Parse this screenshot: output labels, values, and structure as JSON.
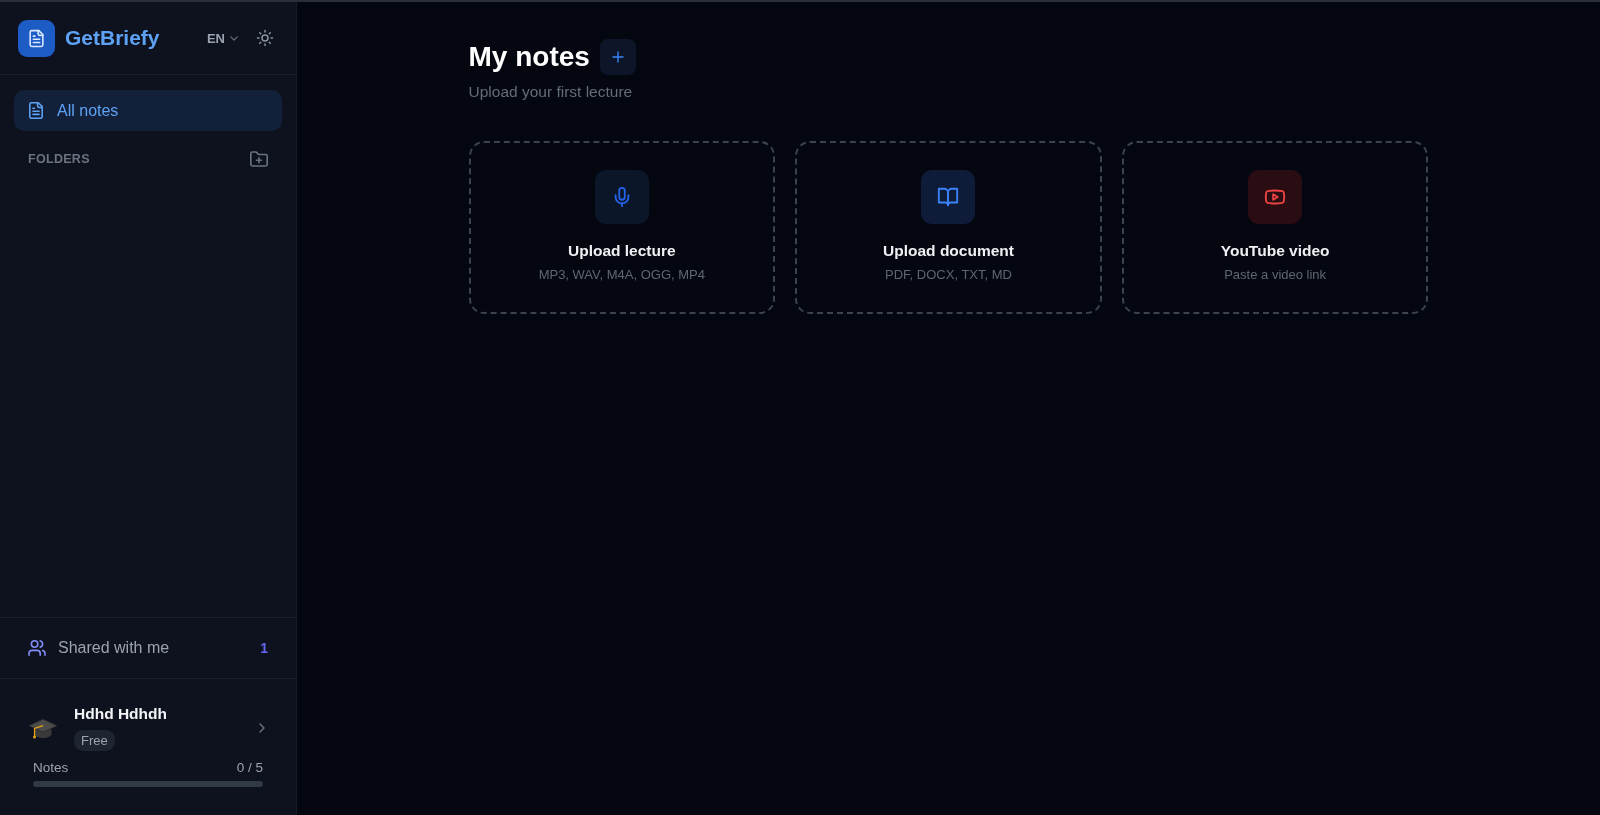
{
  "sidebar": {
    "brand": "GetBriefy",
    "language": "EN",
    "nav": [
      {
        "label": "All notes",
        "selected": true
      }
    ],
    "folders": {
      "heading": "FOLDERS"
    },
    "shared": {
      "label": "Shared with me",
      "count": "1"
    },
    "user": {
      "name": "Hdhd Hdhdh",
      "plan": "Free",
      "usage_label": "Notes",
      "usage_value": "0 / 5",
      "level": 0
    }
  },
  "main": {
    "title": "My notes",
    "subtitle": "Upload your first lecture",
    "cards": [
      {
        "kind": "audio",
        "title": "Upload lecture",
        "hint": "MP3, WAV, M4A, OGG, MP4"
      },
      {
        "kind": "document",
        "title": "Upload document",
        "hint": "PDF, DOCX, TXT, MD"
      },
      {
        "kind": "video",
        "title": "YouTube video",
        "hint": "Paste a video link"
      }
    ]
  }
}
